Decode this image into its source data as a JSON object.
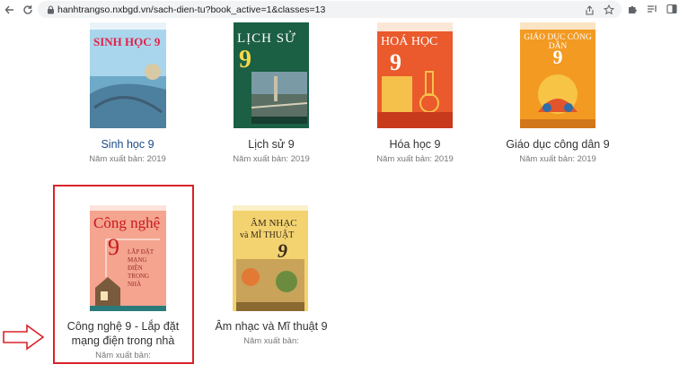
{
  "browser": {
    "url": "hanhtrangso.nxbgd.vn/sach-dien-tu?book_active=1&classes=13"
  },
  "books": [
    {
      "title": "Sinh học 9",
      "year": "Năm xuất bản: 2019",
      "cover_title": "SINH HỌC 9",
      "cover_color": "#8ec6e3"
    },
    {
      "title": "Lịch sử 9",
      "year": "Năm xuất bản: 2019",
      "cover_title": "LỊCH SỬ",
      "cover_num": "9",
      "cover_color": "#1f6b4f"
    },
    {
      "title": "Hóa học 9",
      "year": "Năm xuất bản: 2019",
      "cover_title": "HOÁ HỌC",
      "cover_num": "9",
      "cover_color": "#e84b2a"
    },
    {
      "title": "Giáo dục công dân 9",
      "year": "Năm xuất bản: 2019",
      "cover_title": "GIÁO DỤC CÔNG DÂN",
      "cover_num": "9",
      "cover_color": "#f28a1e"
    },
    {
      "title_line1": "Công nghệ 9 - Lắp đặt",
      "title_line2": "mạng điện trong nhà",
      "year": "Năm xuất bản:",
      "cover_title": "Công nghệ",
      "cover_num": "9",
      "cover_sub": "LẮP ĐẶT MẠNG ĐIỆN TRONG NHÀ",
      "cover_color": "#f6a793"
    },
    {
      "title": "Âm nhạc và Mĩ thuật 9",
      "year": "Năm xuất bản:",
      "cover_title_1": "ÂM NHẠC",
      "cover_title_2": "và MĨ THUẬT",
      "cover_num": "9",
      "cover_color": "#f3d36b"
    }
  ]
}
